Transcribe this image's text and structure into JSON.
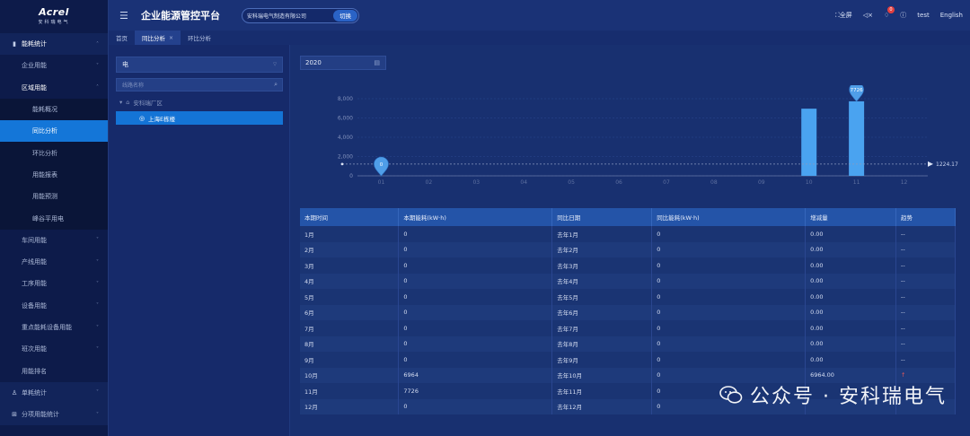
{
  "brand": {
    "logo_main": "Acrel",
    "logo_sub": "安科瑞电气"
  },
  "header": {
    "title": "企业能源管控平台",
    "company": "安科瑞电气制造有限公司",
    "switch_label": "切换",
    "fullscreen_label": "全屏",
    "notifications_count": "0",
    "user": "test",
    "language": "English"
  },
  "tabs": [
    {
      "label": "首页"
    },
    {
      "label": "同比分析"
    },
    {
      "label": "环比分析"
    }
  ],
  "sidebar": {
    "items": [
      {
        "label": "能耗统计"
      },
      {
        "label": "企业用能"
      },
      {
        "label": "区域用能"
      },
      {
        "label": "能耗概况"
      },
      {
        "label": "同比分析"
      },
      {
        "label": "环比分析"
      },
      {
        "label": "用能报表"
      },
      {
        "label": "用能预测"
      },
      {
        "label": "峰谷平用电"
      },
      {
        "label": "车间用能"
      },
      {
        "label": "产线用能"
      },
      {
        "label": "工序用能"
      },
      {
        "label": "设备用能"
      },
      {
        "label": "重点能耗设备用能"
      },
      {
        "label": "班次用能"
      },
      {
        "label": "用能排名"
      },
      {
        "label": "单耗统计"
      },
      {
        "label": "分项用能统计"
      }
    ]
  },
  "filter": {
    "energy_type": "电",
    "search_placeholder": "线路名称",
    "tree_root": "安科瑞厂区",
    "tree_selected": "上海E栋楼",
    "year": "2020"
  },
  "chart_data": {
    "type": "bar",
    "categories": [
      "01",
      "02",
      "03",
      "04",
      "05",
      "06",
      "07",
      "08",
      "09",
      "10",
      "11",
      "12"
    ],
    "values": [
      0,
      0,
      0,
      0,
      0,
      0,
      0,
      0,
      0,
      6964,
      7726,
      0
    ],
    "ylim": [
      0,
      8000
    ],
    "yticks": [
      "0",
      "2,000",
      "4,000",
      "6,000",
      "8,000"
    ],
    "markers": [
      {
        "category": "01",
        "label": "0"
      },
      {
        "category": "11",
        "label": "7726"
      }
    ],
    "average_line": {
      "value": 1224.17,
      "label": "1224.17"
    },
    "colors": {
      "bar": "#4aa3f0",
      "line": "#8a98c0"
    }
  },
  "table": {
    "headers": [
      "本期时间",
      "本期能耗(kW·h)",
      "同比日期",
      "同比能耗(kW·h)",
      "增减量",
      "趋势"
    ],
    "rows": [
      [
        "1月",
        "0",
        "去年1月",
        "0",
        "0.00",
        "--"
      ],
      [
        "2月",
        "0",
        "去年2月",
        "0",
        "0.00",
        "--"
      ],
      [
        "3月",
        "0",
        "去年3月",
        "0",
        "0.00",
        "--"
      ],
      [
        "4月",
        "0",
        "去年4月",
        "0",
        "0.00",
        "--"
      ],
      [
        "5月",
        "0",
        "去年5月",
        "0",
        "0.00",
        "--"
      ],
      [
        "6月",
        "0",
        "去年6月",
        "0",
        "0.00",
        "--"
      ],
      [
        "7月",
        "0",
        "去年7月",
        "0",
        "0.00",
        "--"
      ],
      [
        "8月",
        "0",
        "去年8月",
        "0",
        "0.00",
        "--"
      ],
      [
        "9月",
        "0",
        "去年9月",
        "0",
        "0.00",
        "--"
      ],
      [
        "10月",
        "6964",
        "去年10月",
        "0",
        "6964.00",
        "↑"
      ],
      [
        "11月",
        "7726",
        "去年11月",
        "0",
        "",
        ""
      ],
      [
        "12月",
        "0",
        "去年12月",
        "0",
        "",
        ""
      ]
    ]
  },
  "watermark": "公众号 · 安科瑞电气"
}
